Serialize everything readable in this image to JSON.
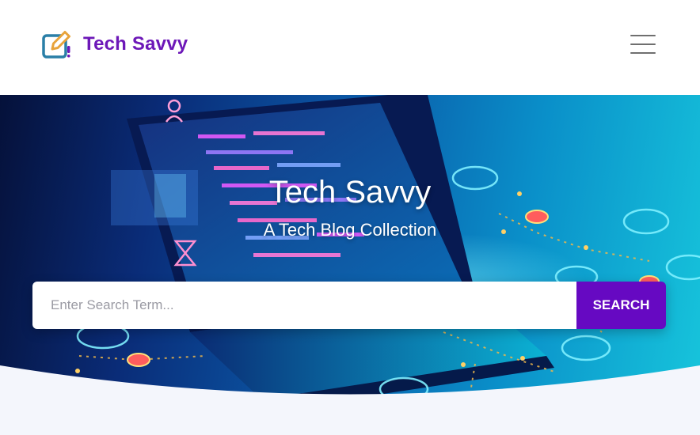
{
  "header": {
    "brand_name": "Tech Savvy",
    "brand_icon": "edit-note-icon",
    "menu_icon": "hamburger-menu-icon"
  },
  "hero": {
    "title": "Tech Savvy",
    "subtitle": "A Tech Blog Collection",
    "search": {
      "placeholder": "Enter Search Term...",
      "value": "",
      "button_label": "SEARCH"
    }
  },
  "colors": {
    "brand": "#6d18b8",
    "button": "#6609c2",
    "page_bg": "#f4f6fc"
  }
}
